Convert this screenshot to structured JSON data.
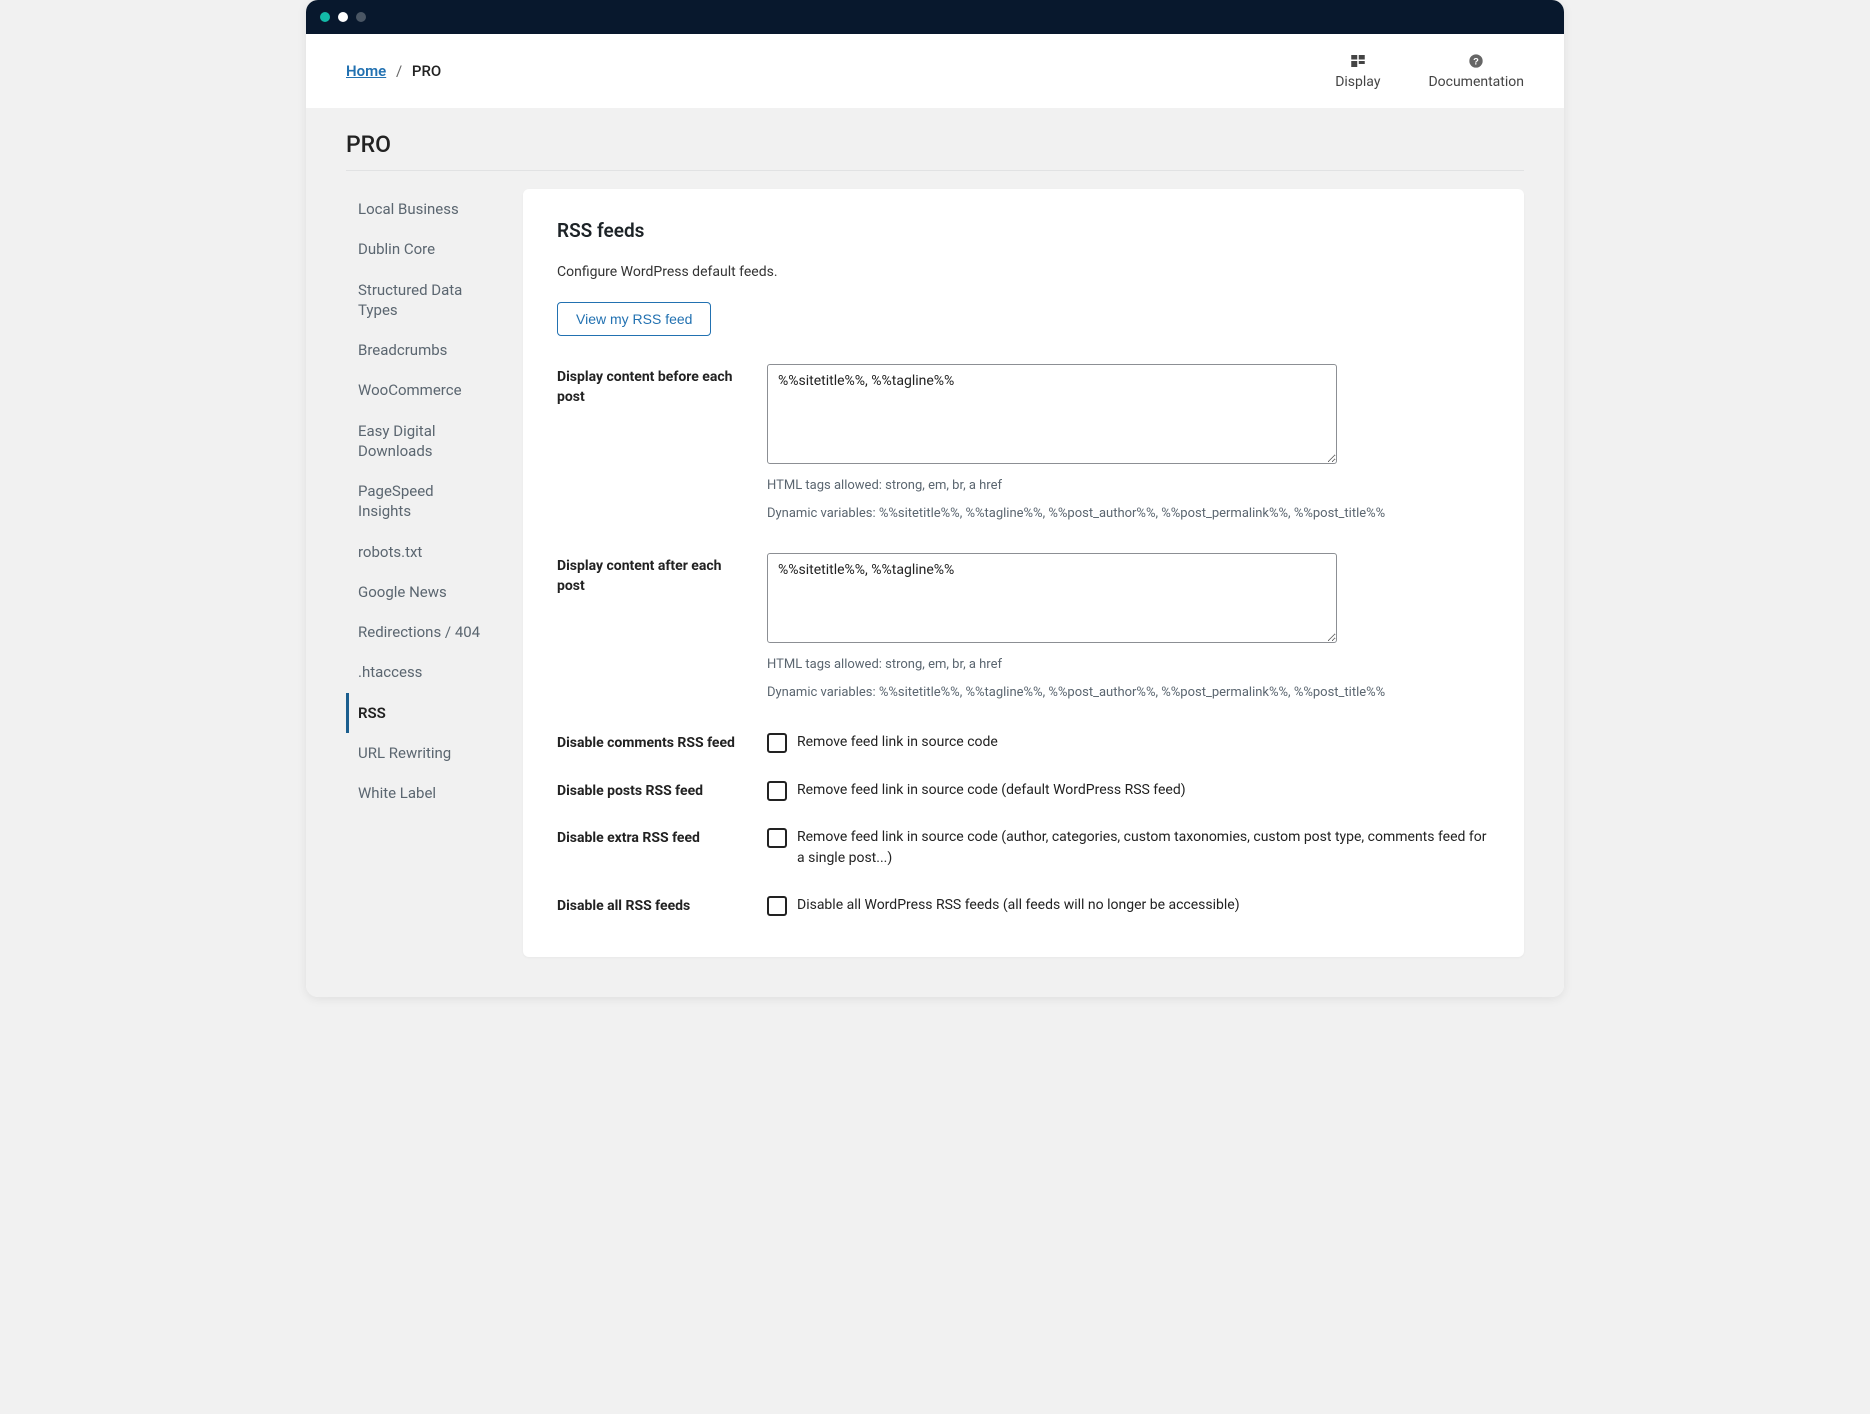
{
  "breadcrumb": {
    "home": "Home",
    "current": "PRO"
  },
  "header_nav": {
    "display": "Display",
    "documentation": "Documentation"
  },
  "page_title": "PRO",
  "sidebar": {
    "items": [
      {
        "label": "Local Business"
      },
      {
        "label": "Dublin Core"
      },
      {
        "label": "Structured Data Types"
      },
      {
        "label": "Breadcrumbs"
      },
      {
        "label": "WooCommerce"
      },
      {
        "label": "Easy Digital Downloads"
      },
      {
        "label": "PageSpeed Insights"
      },
      {
        "label": "robots.txt"
      },
      {
        "label": "Google News"
      },
      {
        "label": "Redirections / 404"
      },
      {
        "label": ".htaccess"
      },
      {
        "label": "RSS"
      },
      {
        "label": "URL Rewriting"
      },
      {
        "label": "White Label"
      }
    ]
  },
  "card": {
    "title": "RSS feeds",
    "desc": "Configure WordPress default feeds.",
    "view_btn": "View my RSS feed",
    "before": {
      "label": "Display content before each post",
      "value": "%%sitetitle%%, %%tagline%%",
      "hint1": "HTML tags allowed: strong, em, br, a href",
      "hint2": "Dynamic variables: %%sitetitle%%, %%tagline%%, %%post_author%%, %%post_permalink%%, %%post_title%%"
    },
    "after": {
      "label": "Display content after each post",
      "value": "%%sitetitle%%, %%tagline%%",
      "hint1": "HTML tags allowed: strong, em, br, a href",
      "hint2": "Dynamic variables: %%sitetitle%%, %%tagline%%, %%post_author%%, %%post_permalink%%, %%post_title%%"
    },
    "cb": {
      "comments": {
        "label": "Disable comments RSS feed",
        "text": "Remove feed link in source code"
      },
      "posts": {
        "label": "Disable posts RSS feed",
        "text": "Remove feed link in source code (default WordPress RSS feed)"
      },
      "extra": {
        "label": "Disable extra RSS feed",
        "text": "Remove feed link in source code (author, categories, custom taxonomies, custom post type, comments feed for a single post...)"
      },
      "all": {
        "label": "Disable all RSS feeds",
        "text": "Disable all WordPress RSS feeds (all feeds will no longer be accessible)"
      }
    }
  }
}
